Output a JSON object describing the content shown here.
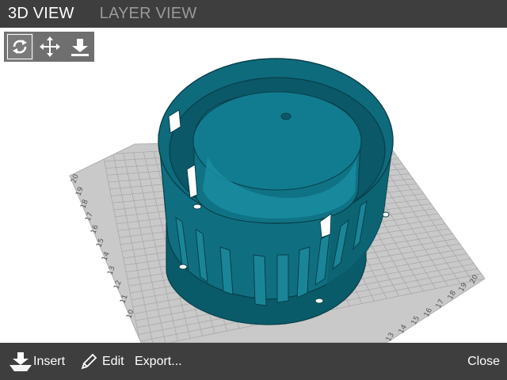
{
  "tabs": [
    {
      "label": "3D VIEW",
      "active": true
    },
    {
      "label": "LAYER VIEW",
      "active": false
    }
  ],
  "view_tools": [
    {
      "icon": "rotate-icon",
      "selected": true
    },
    {
      "icon": "move-icon",
      "selected": false
    },
    {
      "icon": "lay-flat-icon",
      "selected": false
    }
  ],
  "grid": {
    "left_axis_labels": [
      "20",
      "19",
      "18",
      "17",
      "16",
      "15",
      "14",
      "13",
      "12",
      "11",
      "10"
    ],
    "front_axis_labels": [
      "13",
      "14",
      "15",
      "16",
      "17",
      "18",
      "19",
      "20"
    ]
  },
  "model": {
    "color": "#0d6a7a"
  },
  "colors": {
    "bar": "#3e3e3e",
    "grid_plate": "#c8c8c8",
    "model": "#0d6a7a"
  },
  "bottom_bar": {
    "insert_label": "Insert",
    "edit_label": "Edit",
    "export_label": "Export...",
    "close_label": "Close"
  }
}
